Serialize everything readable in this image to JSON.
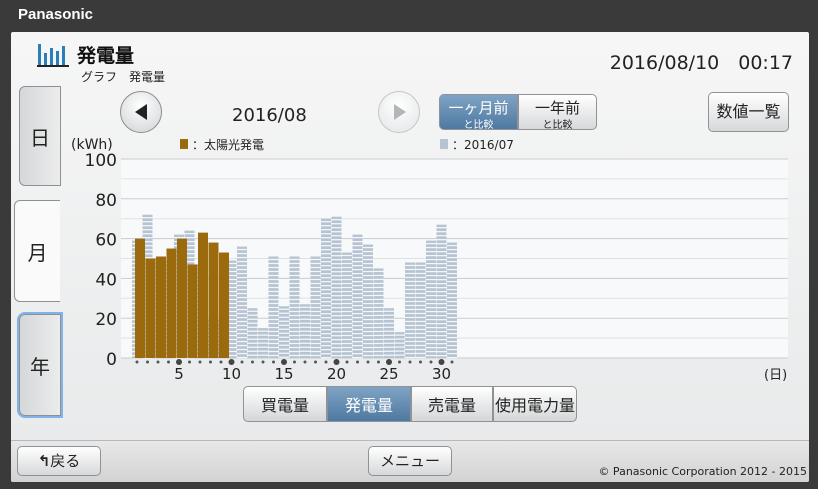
{
  "brand": "Panasonic",
  "header": {
    "title": "発電量",
    "breadcrumb": "グラフ　発電量",
    "datetime": "2016/08/10　00:17"
  },
  "side_tabs": [
    {
      "label": "日"
    },
    {
      "label": "月"
    },
    {
      "label": "年"
    }
  ],
  "nav": {
    "period": "2016/08",
    "compare_month_main": "一ヶ月前",
    "compare_month_sub": "と比較",
    "compare_year_main": "一年前",
    "compare_year_sub": "と比較",
    "list_button": "数値一覧"
  },
  "colors": {
    "accent": "#5a83ab",
    "current_bar": "#9b6a0c",
    "previous_bar": "#b6c3d2"
  },
  "chart_data": {
    "type": "bar",
    "ylabel": "(kWh)",
    "ylim": [
      0,
      100
    ],
    "yticks": [
      0,
      20,
      40,
      60,
      80,
      100
    ],
    "xticks": [
      "5",
      "10",
      "15",
      "20",
      "25",
      "30"
    ],
    "x_unit": "(日)",
    "categories": [
      1,
      2,
      3,
      4,
      5,
      6,
      7,
      8,
      9,
      10,
      11,
      12,
      13,
      14,
      15,
      16,
      17,
      18,
      19,
      20,
      21,
      22,
      23,
      24,
      25,
      26,
      27,
      28,
      29,
      30,
      31
    ],
    "series": [
      {
        "name": "：太陽光発電",
        "values": [
          60,
          50,
          51,
          55,
          60,
          47,
          63,
          58,
          53
        ]
      },
      {
        "name": "：2016/07",
        "values": [
          59,
          72,
          50,
          49,
          62,
          64,
          47,
          19,
          19,
          49,
          56,
          25,
          15,
          51,
          26,
          51,
          27,
          51,
          70,
          71,
          53,
          62,
          57,
          45,
          25,
          13,
          48,
          48,
          59,
          67,
          58
        ]
      }
    ]
  },
  "view_tabs": [
    {
      "label": "買電量"
    },
    {
      "label": "発電量"
    },
    {
      "label": "売電量"
    },
    {
      "label": "使用電力量"
    }
  ],
  "footer": {
    "back": "戻る",
    "menu": "メニュー",
    "copyright": "© Panasonic Corporation 2012 - 2015"
  }
}
